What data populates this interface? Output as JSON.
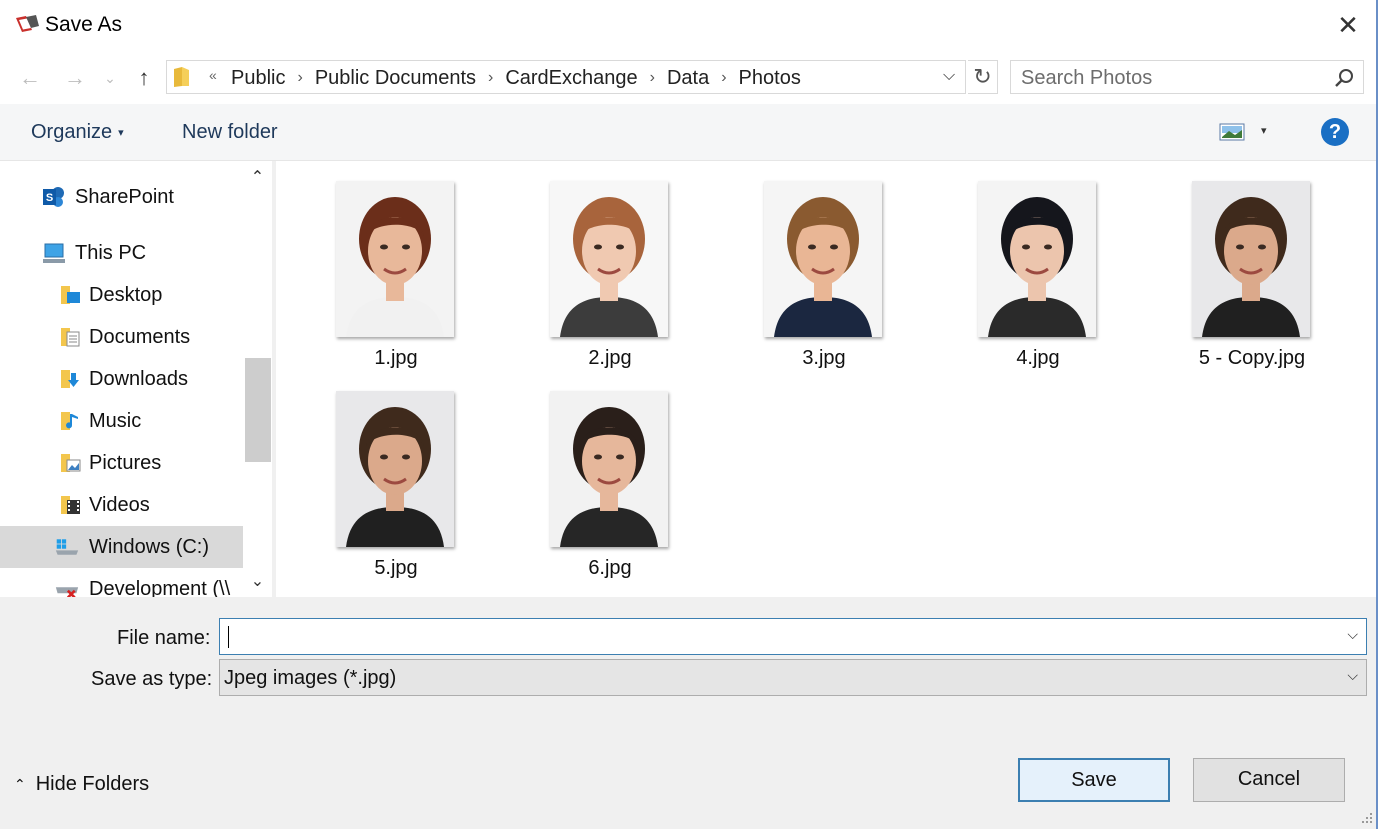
{
  "window": {
    "title": "Save As",
    "icon": "cardexchange-app-icon",
    "close_icon": "close-icon"
  },
  "address_bar": {
    "overflow_chevron": "«",
    "breadcrumbs": [
      "Public",
      "Public Documents",
      "CardExchange",
      "Data",
      "Photos"
    ],
    "separator": "›"
  },
  "search": {
    "placeholder": "Search Photos"
  },
  "toolbar": {
    "organize_label": "Organize",
    "new_folder_label": "New folder",
    "help_label": "?"
  },
  "nav_tree": [
    {
      "label": "SharePoint",
      "icon": "sharepoint-icon"
    },
    {
      "label": "This PC",
      "icon": "computer-icon"
    },
    {
      "label": "Desktop",
      "icon": "desktop-folder-icon"
    },
    {
      "label": "Documents",
      "icon": "documents-folder-icon"
    },
    {
      "label": "Downloads",
      "icon": "downloads-folder-icon"
    },
    {
      "label": "Music",
      "icon": "music-folder-icon"
    },
    {
      "label": "Pictures",
      "icon": "pictures-folder-icon"
    },
    {
      "label": "Videos",
      "icon": "videos-folder-icon"
    },
    {
      "label": "Windows (C:)",
      "icon": "windows-drive-icon",
      "selected": true
    },
    {
      "label": "Development (\\\\",
      "icon": "network-drive-disconnected-icon"
    }
  ],
  "files": [
    {
      "name": "1.jpg",
      "palette": {
        "bg": "#f3f3f3",
        "hair": "#6b2e1a",
        "skin": "#e8b89a",
        "clothes": "#f1f1f1"
      }
    },
    {
      "name": "2.jpg",
      "palette": {
        "bg": "#f7f7f7",
        "hair": "#a8643c",
        "skin": "#f0c9b1",
        "clothes": "#3c3c3c"
      }
    },
    {
      "name": "3.jpg",
      "palette": {
        "bg": "#f5f5f5",
        "hair": "#8a5a30",
        "skin": "#e9b695",
        "clothes": "#1b2740"
      }
    },
    {
      "name": "4.jpg",
      "palette": {
        "bg": "#f4f4f4",
        "hair": "#15161c",
        "skin": "#ecc5ad",
        "clothes": "#2a2a2a"
      }
    },
    {
      "name": "5 - Copy.jpg",
      "palette": {
        "bg": "#e8e8ea",
        "hair": "#3f2a1c",
        "skin": "#dba98b",
        "clothes": "#202020"
      }
    },
    {
      "name": "5.jpg",
      "palette": {
        "bg": "#e8e8ea",
        "hair": "#3f2a1c",
        "skin": "#dba98b",
        "clothes": "#202020"
      }
    },
    {
      "name": "6.jpg",
      "palette": {
        "bg": "#f2f2f2",
        "hair": "#2a1f1a",
        "skin": "#e6b79b",
        "clothes": "#262626"
      }
    }
  ],
  "form": {
    "file_name_label": "File name:",
    "file_name_value": "",
    "save_type_label": "Save as type:",
    "save_type_value": "Jpeg images (*.jpg)"
  },
  "footer": {
    "hide_folders_label": "Hide Folders",
    "save_label": "Save",
    "cancel_label": "Cancel"
  },
  "colors": {
    "accent": "#3c7fb1",
    "help_blue": "#1a6fc4",
    "selection_gray": "#d9d9d9",
    "toolbar_bg": "#f5f6f7",
    "footer_bg": "#f0f0f0",
    "link_text": "#1e395b"
  }
}
